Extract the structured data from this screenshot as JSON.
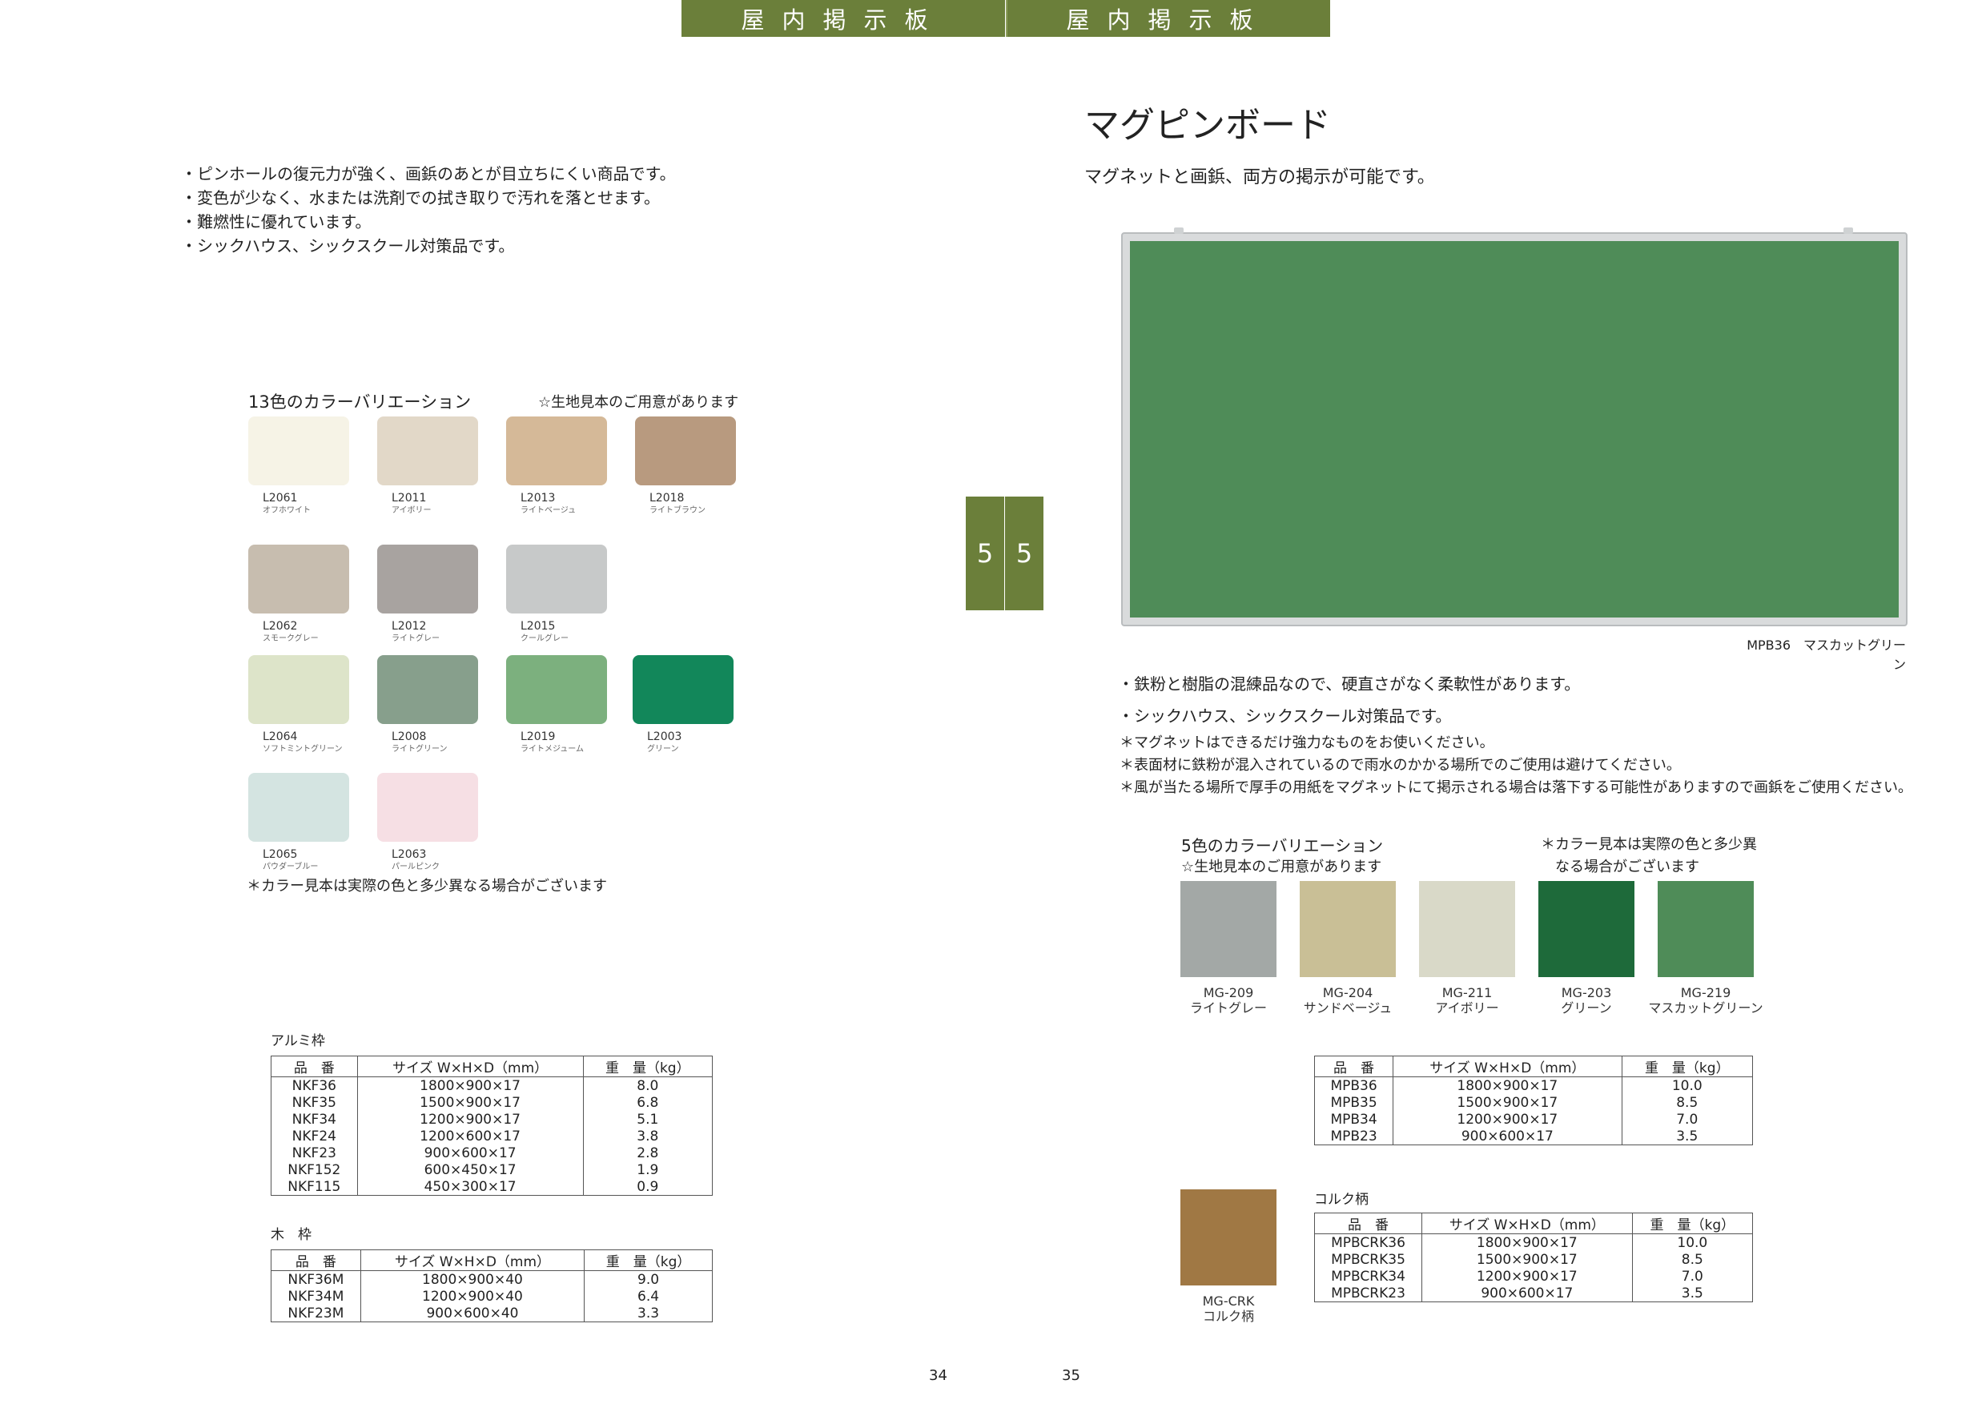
{
  "header": {
    "left": "屋内掲示板",
    "right": "屋内掲示板"
  },
  "tab": {
    "left": "5",
    "right": "5"
  },
  "left": {
    "bullets": [
      "・ピンホールの復元力が強く、画鋲のあとが目立ちにくい商品です。",
      "・変色が少なく、水または洗剤での拭き取りで汚れを落とせます。",
      "・難燃性に優れています。",
      "・シックハウス、シックスクール対策品です。"
    ],
    "variation_title": "13色のカラーバリエーション",
    "sample_note": "☆生地見本のご用意があります",
    "swatches": [
      {
        "code": "L2061",
        "name": "オフホワイト",
        "color": "#f6f3e6"
      },
      {
        "code": "L2011",
        "name": "アイボリー",
        "color": "#e2d8c8"
      },
      {
        "code": "L2013",
        "name": "ライトベージュ",
        "color": "#d5b998"
      },
      {
        "code": "L2018",
        "name": "ライトブラウン",
        "color": "#b89a7f"
      },
      {
        "code": "L2062",
        "name": "スモークグレー",
        "color": "#c7bdaf"
      },
      {
        "code": "L2012",
        "name": "ライトグレー",
        "color": "#a8a3a0"
      },
      {
        "code": "L2015",
        "name": "クールグレー",
        "color": "#c7c9c9"
      },
      {
        "code": "L2064",
        "name": "ソフトミントグリーン",
        "color": "#dde4c9"
      },
      {
        "code": "L2008",
        "name": "ライトグリーン",
        "color": "#879f8c"
      },
      {
        "code": "L2019",
        "name": "ライトメジューム",
        "color": "#7cb07e"
      },
      {
        "code": "L2003",
        "name": "グリーン",
        "color": "#12875a"
      },
      {
        "code": "L2065",
        "name": "パウダーブルー",
        "color": "#d4e4e1"
      },
      {
        "code": "L2063",
        "name": "パールピンク",
        "color": "#f6dfe4"
      }
    ],
    "color_note": "＊カラー見本は実際の色と多少異なる場合がございます",
    "alumi": {
      "title": "アルミ枠",
      "headers": [
        "品　番",
        "サイズ W×H×D（mm）",
        "重　量（kg）"
      ],
      "rows": [
        [
          "NKF36",
          "1800×900×17",
          "8.0"
        ],
        [
          "NKF35",
          "1500×900×17",
          "6.8"
        ],
        [
          "NKF34",
          "1200×900×17",
          "5.1"
        ],
        [
          "NKF24",
          "1200×600×17",
          "3.8"
        ],
        [
          "NKF23",
          "900×600×17",
          "2.8"
        ],
        [
          "NKF152",
          "600×450×17",
          "1.9"
        ],
        [
          "NKF115",
          "450×300×17",
          "0.9"
        ]
      ]
    },
    "wood": {
      "title": "木　枠",
      "headers": [
        "品　番",
        "サイズ W×H×D（mm）",
        "重　量（kg）"
      ],
      "rows": [
        [
          "NKF36M",
          "1800×900×40",
          "9.0"
        ],
        [
          "NKF34M",
          "1200×900×40",
          "6.4"
        ],
        [
          "NKF23M",
          "900×600×40",
          "3.3"
        ]
      ]
    },
    "page_number": "34"
  },
  "right": {
    "title": "マグピンボード",
    "subtitle": "マグネットと画鋲、両方の掲示が可能です。",
    "board_caption": "MPB36　マスカットグリーン",
    "bullets": [
      "・鉄粉と樹脂の混練品なので、硬直さがなく柔軟性があります。",
      "・シックハウス、シックスクール対策品です。"
    ],
    "notes": [
      "＊マグネットはできるだけ強力なものをお使いください。",
      "＊表面材に鉄粉が混入されているので雨水のかかる場所でのご使用は避けてください。",
      "＊風が当たる場所で厚手の用紙をマグネットにて掲示される場合は落下する可能性がありますので画鋲をご使用ください。"
    ],
    "variation_title": "5色のカラーバリエーション",
    "sample_note": "☆生地見本のご用意があります",
    "color_note_1": "＊カラー見本は実際の色と多少異",
    "color_note_2": "なる場合がございます",
    "swatches": [
      {
        "code": "MG-209",
        "name": "ライトグレー",
        "color": "#a3a8a6"
      },
      {
        "code": "MG-204",
        "name": "サンドベージュ",
        "color": "#c9bf96"
      },
      {
        "code": "MG-211",
        "name": "アイボリー",
        "color": "#d9d9c8"
      },
      {
        "code": "MG-203",
        "name": "グリーン",
        "color": "#1e6a3a"
      },
      {
        "code": "MG-219",
        "name": "マスカットグリーン",
        "color": "#4f8c58"
      }
    ],
    "spec": {
      "headers": [
        "品　番",
        "サイズ W×H×D（mm）",
        "重　量（kg）"
      ],
      "rows": [
        [
          "MPB36",
          "1800×900×17",
          "10.0"
        ],
        [
          "MPB35",
          "1500×900×17",
          "8.5"
        ],
        [
          "MPB34",
          "1200×900×17",
          "7.0"
        ],
        [
          "MPB23",
          "900×600×17",
          "3.5"
        ]
      ]
    },
    "cork": {
      "title": "コルク柄",
      "code": "MG-CRK",
      "name": "コルク柄",
      "color": "#a07844",
      "headers": [
        "品　番",
        "サイズ W×H×D（mm）",
        "重　量（kg）"
      ],
      "rows": [
        [
          "MPBCRK36",
          "1800×900×17",
          "10.0"
        ],
        [
          "MPBCRK35",
          "1500×900×17",
          "8.5"
        ],
        [
          "MPBCRK34",
          "1200×900×17",
          "7.0"
        ],
        [
          "MPBCRK23",
          "900×600×17",
          "3.5"
        ]
      ]
    },
    "page_number": "35"
  }
}
